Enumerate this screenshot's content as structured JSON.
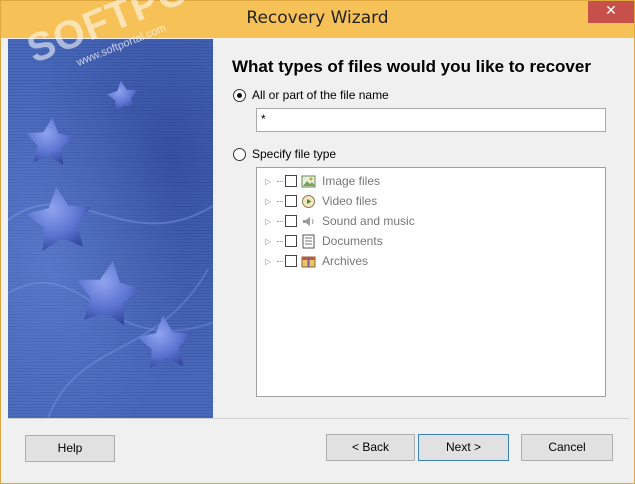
{
  "window": {
    "title": "Recovery Wizard",
    "close_glyph": "✕"
  },
  "watermark": {
    "brand": "SOFTPORTAL",
    "site": "www.softportal.com"
  },
  "content": {
    "heading": "What types of files would you like to recover",
    "option_filename_label": "All or part of the file name",
    "filename_value": "*",
    "option_filetype_label": "Specify file type",
    "file_types": [
      {
        "label": "Image files",
        "icon": "image-icon"
      },
      {
        "label": "Video files",
        "icon": "video-icon"
      },
      {
        "label": "Sound and music",
        "icon": "sound-icon"
      },
      {
        "label": "Documents",
        "icon": "document-icon"
      },
      {
        "label": "Archives",
        "icon": "archive-icon"
      }
    ]
  },
  "buttons": {
    "help": "Help",
    "back": "< Back",
    "next": "Next >",
    "cancel": "Cancel"
  },
  "colors": {
    "titlebar": "#f6c157",
    "close": "#c7504a",
    "banner": "#4a68b9",
    "stars": "#5b74d1"
  }
}
